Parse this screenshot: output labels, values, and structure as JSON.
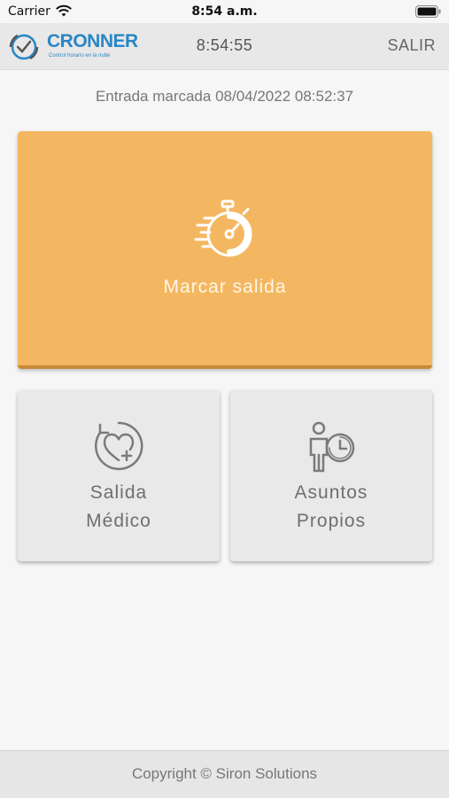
{
  "status_bar": {
    "carrier": "Carrier",
    "time": "8:54 a.m."
  },
  "header": {
    "logo_text": "CRONNER",
    "logo_subtitle": "Control horario en la nube",
    "clock": "8:54:55",
    "logout_label": "SALIR",
    "brand_color": "#2a86c6"
  },
  "entry_info": "Entrada marcada 08/04/2022 08:52:37",
  "main_action": {
    "label": "Marcar salida",
    "icon": "stopwatch-icon",
    "color": "#f4b761"
  },
  "secondary_actions": [
    {
      "line1": "Salida",
      "line2": "Médico",
      "icon": "heart-medical-icon"
    },
    {
      "line1": "Asuntos",
      "line2": "Propios",
      "icon": "person-clock-icon"
    }
  ],
  "footer": {
    "copyright": "Copyright © Siron Solutions"
  }
}
